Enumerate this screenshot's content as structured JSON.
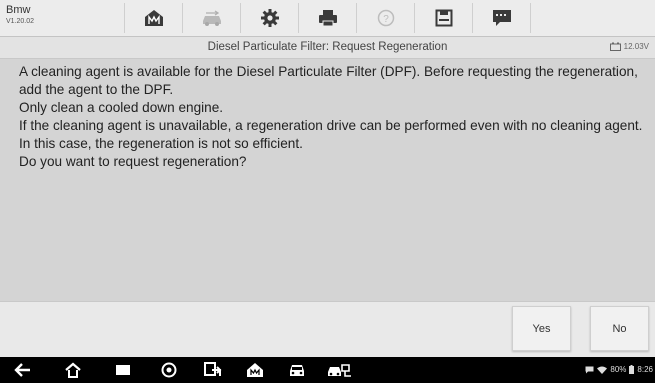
{
  "app": {
    "name": "Bmw",
    "version": "V1.20.02"
  },
  "toolbar": {
    "items": [
      {
        "name": "home-icon"
      },
      {
        "name": "vehicle-swap-icon"
      },
      {
        "name": "settings-icon"
      },
      {
        "name": "print-icon"
      },
      {
        "name": "help-icon"
      },
      {
        "name": "save-icon"
      },
      {
        "name": "data-logging-icon"
      }
    ]
  },
  "header": {
    "title": "Diesel Particulate Filter: Request Regeneration",
    "voltage": "12.03V"
  },
  "message": {
    "lines": [
      "A cleaning agent is available for the Diesel Particulate Filter (DPF). Before requesting the regeneration, add the agent to the DPF.",
      "Only clean a cooled down engine.",
      "If the cleaning agent is unavailable, a regeneration drive can be performed even with no cleaning agent. In this case, the regeneration is not so efficient.",
      "Do you want to request regeneration?"
    ]
  },
  "actions": {
    "yes_label": "Yes",
    "no_label": "No"
  },
  "statusbar": {
    "battery": "80%",
    "time": "8:26"
  },
  "colors": {
    "background": "#d4d4d4",
    "navbar": "#000000"
  }
}
